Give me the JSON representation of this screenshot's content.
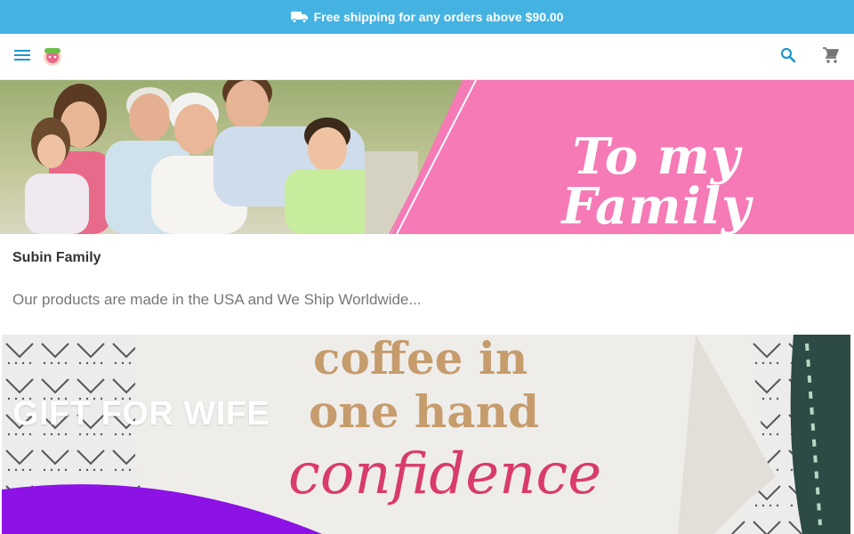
{
  "announcement": {
    "icon": "truck-icon",
    "text": "Free shipping for any orders above $90.00"
  },
  "header": {
    "menu_icon": "menu-icon",
    "logo": "subin-family-logo",
    "search_icon": "search-icon",
    "cart_icon": "cart-icon"
  },
  "hero": {
    "banner_text": "To my Family"
  },
  "store": {
    "name": "Subin Family",
    "description": "Our products are made in the USA and We Ship Worldwide..."
  },
  "feature": {
    "title": "GIFT FOR WIFE",
    "shirt_line_1": "coffee in",
    "shirt_line_2": "one hand",
    "shirt_script": "confidence"
  },
  "colors": {
    "announcement_bg": "#44b3e2",
    "accent_blue": "#2196c9",
    "banner_pink": "#f57ab5",
    "icon_gray": "#757575"
  }
}
